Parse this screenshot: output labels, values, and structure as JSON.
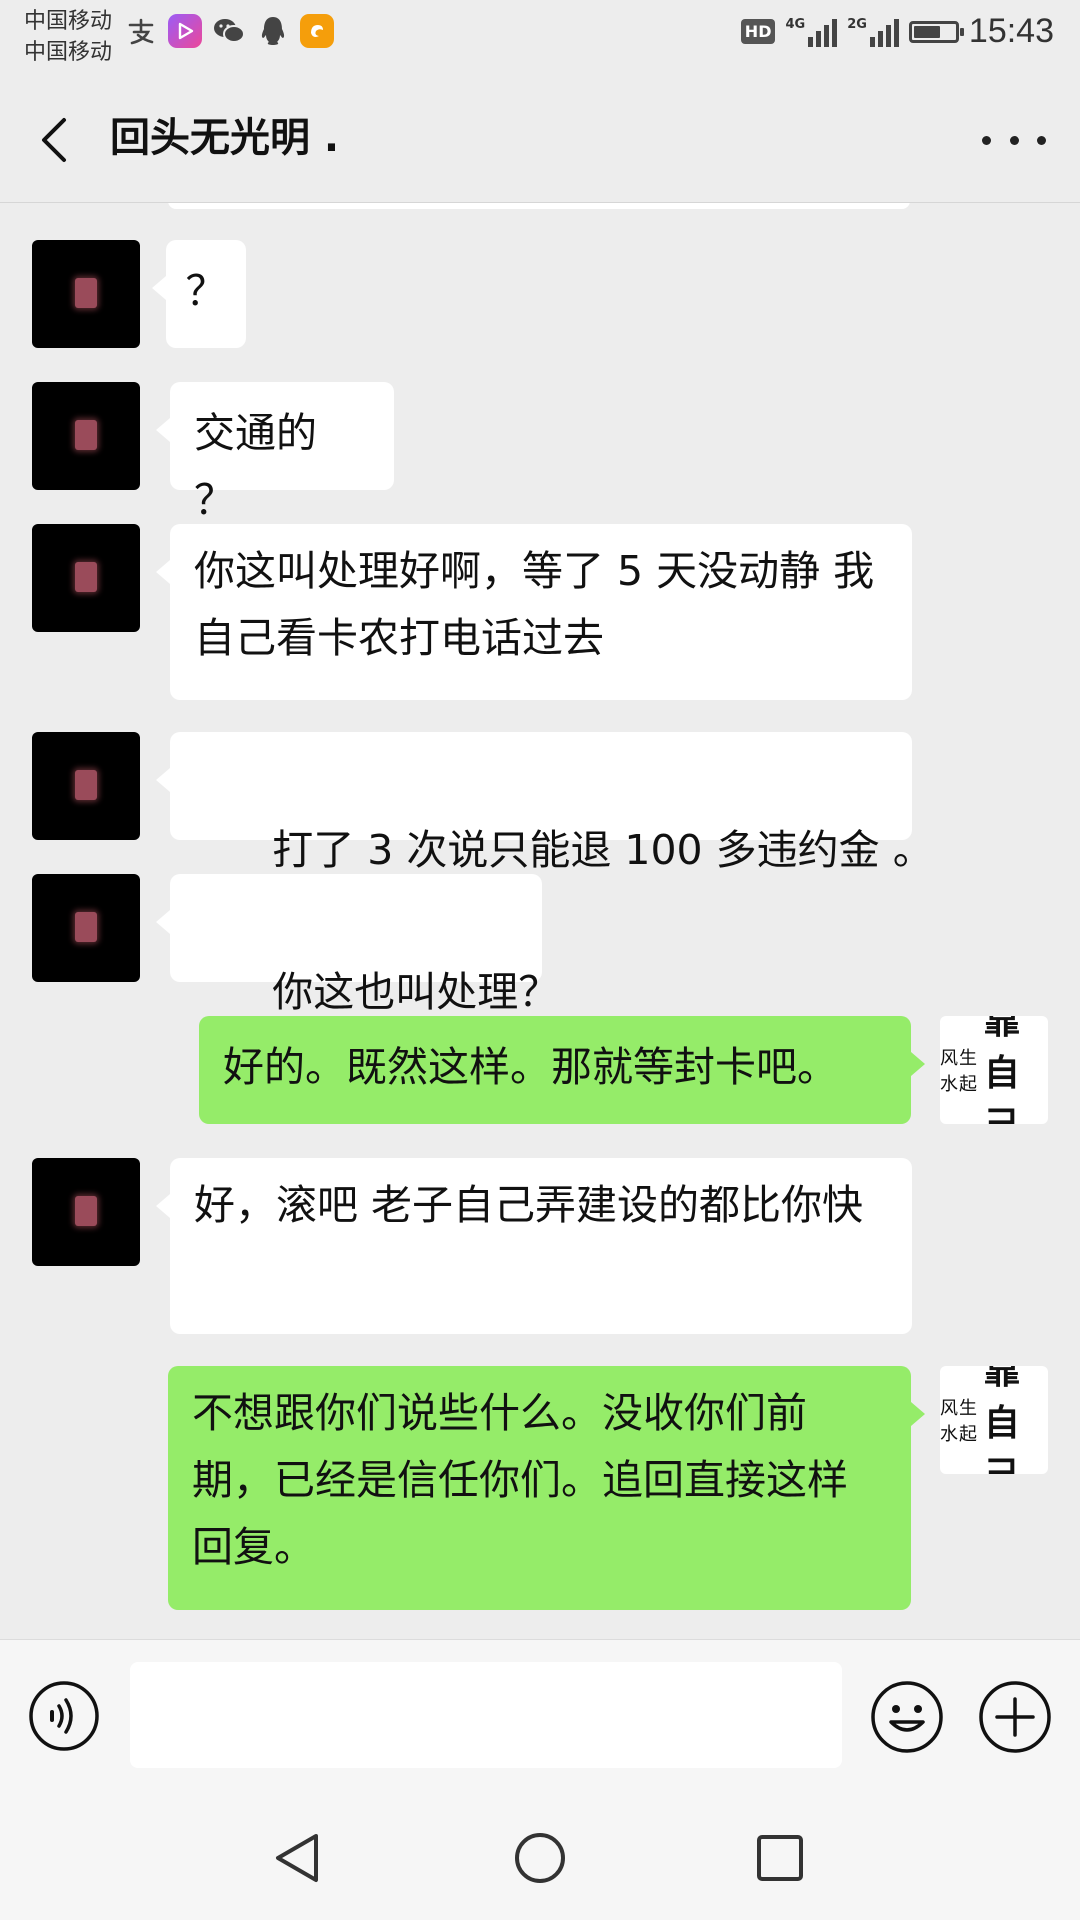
{
  "status_bar": {
    "carrier_1": "中国移动",
    "carrier_2": "中国移动",
    "hd": "HD",
    "signal_1_label": "4G",
    "signal_2_label": "2G",
    "time": "15:43",
    "app_icons": [
      "alipay-icon",
      "video-app-icon",
      "wechat-icon",
      "qq-icon",
      "uc-browser-icon"
    ]
  },
  "header": {
    "title": "回头无光明 ."
  },
  "messages": [
    {
      "side": "in",
      "text": "？"
    },
    {
      "side": "in",
      "text": "交通的 ？"
    },
    {
      "side": "in",
      "text": "你这叫处理好啊，等了 5 天没动静 我自己看卡农打电话过去"
    },
    {
      "side": "in",
      "text": "  打了 3 次说只能退 100 多违约金 。"
    },
    {
      "side": "in",
      "text": "  你这也叫处理？"
    },
    {
      "side": "out",
      "text": "好的。既然这样。那就等封卡吧。"
    },
    {
      "side": "in",
      "text": "好，滚吧 老子自己弄建设的都比你快"
    },
    {
      "side": "out",
      "text": "不想跟你们说些什么。没收你们前期，已经是信任你们。追回直接这样回复。"
    }
  ],
  "my_avatar": {
    "small_text": "风生水起",
    "big_text": "靠自己"
  },
  "input": {
    "value": "",
    "placeholder": ""
  },
  "colors": {
    "background": "#ededed",
    "outgoing_bubble": "#95ec69",
    "incoming_bubble": "#ffffff"
  }
}
